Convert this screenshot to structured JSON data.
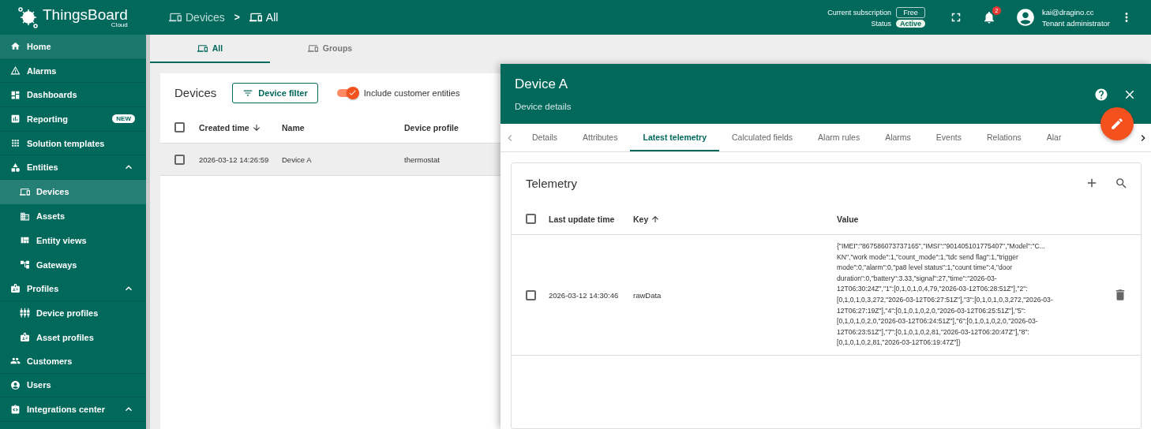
{
  "brand": {
    "name": "ThingsBoard",
    "sub": "Cloud"
  },
  "breadcrumb": [
    {
      "label": "Devices",
      "current": false
    },
    {
      "label": "All",
      "current": true
    }
  ],
  "breadcrumb_separator": ">",
  "subscription": {
    "label": "Current subscription",
    "plan": "Free",
    "status_label": "Status",
    "status": "Active"
  },
  "notifications": {
    "count": "2"
  },
  "user": {
    "email": "kai@dragino.cc",
    "role": "Tenant administrator"
  },
  "sidebar": {
    "items": [
      {
        "label": "Home",
        "selected": false,
        "hovered": true
      },
      {
        "label": "Alarms",
        "selected": false,
        "hovered": false
      },
      {
        "label": "Dashboards",
        "selected": false,
        "hovered": false
      },
      {
        "label": "Reporting",
        "selected": false,
        "hovered": false,
        "badge": "NEW"
      },
      {
        "label": "Solution templates",
        "selected": false,
        "hovered": false
      },
      {
        "label": "Entities",
        "selected": false,
        "hovered": false,
        "expanded": true,
        "children": [
          {
            "label": "Devices",
            "selected": true,
            "hovered": false
          },
          {
            "label": "Assets",
            "selected": false,
            "hovered": false
          },
          {
            "label": "Entity views",
            "selected": false,
            "hovered": false
          },
          {
            "label": "Gateways",
            "selected": false,
            "hovered": false
          }
        ]
      },
      {
        "label": "Profiles",
        "selected": false,
        "hovered": false,
        "expanded": true,
        "children": [
          {
            "label": "Device profiles",
            "selected": false,
            "hovered": false
          },
          {
            "label": "Asset profiles",
            "selected": false,
            "hovered": false
          }
        ]
      },
      {
        "label": "Customers",
        "selected": false,
        "hovered": false
      },
      {
        "label": "Users",
        "selected": false,
        "hovered": false
      },
      {
        "label": "Integrations center",
        "selected": false,
        "hovered": false,
        "expanded": true
      }
    ]
  },
  "view_tabs": [
    {
      "label": "All",
      "selected": true
    },
    {
      "label": "Groups",
      "selected": false
    }
  ],
  "devices": {
    "title": "Devices",
    "filter_button": "Device filter",
    "include_customer": {
      "label": "Include customer entities",
      "on": true
    },
    "all_checked": false,
    "columns": [
      {
        "label": "Created time",
        "sorted": true,
        "ascending": false
      },
      {
        "label": "Name",
        "sorted": false
      },
      {
        "label": "Device profile",
        "sorted": false
      }
    ],
    "rows": [
      {
        "checked": false,
        "cells": [
          "2026-03-12 14:26:59",
          "Device A",
          "thermostat"
        ]
      }
    ]
  },
  "details": {
    "title": "Device A",
    "subtitle": "Device details",
    "tabs": [
      {
        "label": "Details",
        "selected": false
      },
      {
        "label": "Attributes",
        "selected": false
      },
      {
        "label": "Latest telemetry",
        "selected": true
      },
      {
        "label": "Calculated fields",
        "selected": false
      },
      {
        "label": "Alarm rules",
        "selected": false
      },
      {
        "label": "Alarms",
        "selected": false
      },
      {
        "label": "Events",
        "selected": false
      },
      {
        "label": "Relations",
        "selected": false
      },
      {
        "label": "Alar",
        "selected": false
      }
    ],
    "telemetry": {
      "title": "Telemetry",
      "all_checked": false,
      "columns": [
        {
          "label": "Last update time",
          "sorted": false
        },
        {
          "label": "Key",
          "sorted": true,
          "ascending": true
        },
        {
          "label": "Value",
          "sorted": false
        }
      ],
      "rows": [
        {
          "checked": false,
          "time": "2026-03-12 14:30:46",
          "key": "rawData",
          "value_lines": [
            "{\"IMEI\":\"867586073737165\",\"IMSI\":\"901405101775407\",\"Model\":\"C...",
            "KN\",\"work mode\":1,\"count_mode\":1,\"tdc send flag\":1,\"trigger",
            "mode\":0,\"alarm\":0,\"pa8 level status\":1,\"count time\":4,\"door",
            "duration\":0,\"battery\":3.33,\"signal\":27,\"time\":\"2026-03-",
            "12T06:30:24Z\",\"1\":[0,1,0,1,0,4,79,\"2026-03-12T06:28:51Z\"],\"2\":",
            "[0,1,0,1,0,3,272,\"2026-03-12T06:27:51Z\"],\"3\":[0,1,0,1,0,3,272,\"2026-03-",
            "12T06:27:19Z\"],\"4\":[0,1,0,1,0,2,0,\"2026-03-12T06:25:51Z\"],\"5\":",
            "[0,1,0,1,0,2,0,\"2026-03-12T06:24:51Z\"],\"6\":[0,1,0,1,0,2,0,\"2026-03-",
            "12T06:23:51Z\"],\"7\":[0,1,0,1,0,2,81,\"2026-03-12T06:20:47Z\"],\"8\":",
            "[0,1,0,1,0,2,81,\"2026-03-12T06:19:47Z\"]}"
          ]
        }
      ]
    }
  }
}
